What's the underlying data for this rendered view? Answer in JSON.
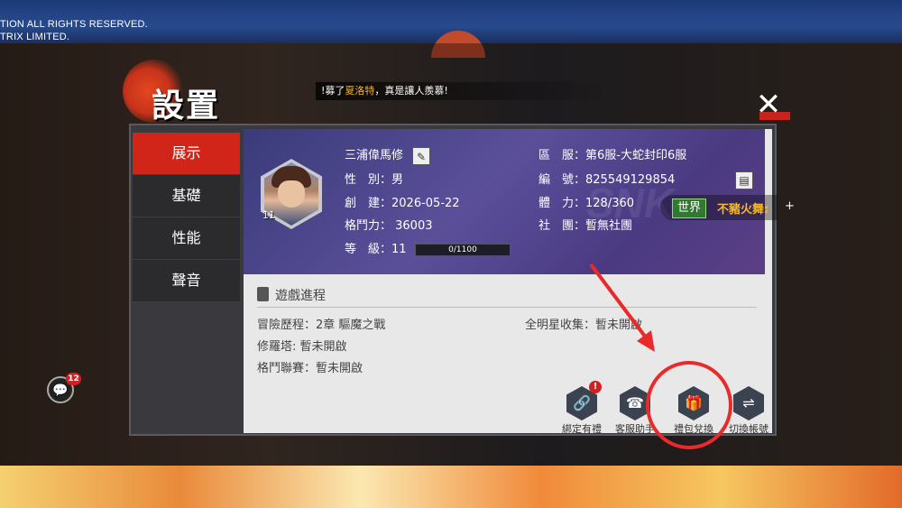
{
  "copyright": {
    "line1": "TION ALL RIGHTS RESERVED.",
    "line2": "TRIX LIMITED."
  },
  "header": {
    "title": "設置",
    "ticker_prefix": "!募了",
    "ticker_name": "夏洛特",
    "ticker_suffix": "，真是讓人羨慕!"
  },
  "close_label": "✕",
  "sidebar": {
    "items": [
      {
        "label": "展示",
        "active": true
      },
      {
        "label": "基礎",
        "active": false
      },
      {
        "label": "性能",
        "active": false
      },
      {
        "label": "聲音",
        "active": false
      }
    ]
  },
  "profile": {
    "name": "三浦偉馬修",
    "avatar_level": "11",
    "gender": "性　別：男",
    "created": "創　建：2026-05-22",
    "power": "格鬥力： 36003",
    "level": "等　級：11",
    "exp": "0/1100",
    "server": "區　服：第6服-大蛇封印6服",
    "id": "編　號：825549129854",
    "stamina": "體　力：128/360",
    "guild": "社　團：暫無社團"
  },
  "world_chat": {
    "tag": "世界",
    "message": "不豬火舞:",
    "plus": "+"
  },
  "progress": {
    "title": "遊戲進程",
    "adventure": "冒險歷程：2章  驅魔之戰",
    "tower": "修羅塔:    暫未開啟",
    "league": "格鬥聯賽：暫未開啟",
    "allstar": "全明星收集：暫未開啟"
  },
  "actions": [
    {
      "label": "綁定有禮",
      "icon": "link-icon",
      "glyph": "🔗",
      "badge": "!"
    },
    {
      "label": "客服助手",
      "icon": "headset-icon",
      "glyph": "☎",
      "badge": ""
    },
    {
      "label": "禮包兌換",
      "icon": "gift-icon",
      "glyph": "🎁",
      "badge": ""
    },
    {
      "label": "切換帳號",
      "icon": "switch-account-icon",
      "glyph": "⇌",
      "badge": ""
    }
  ],
  "chat_float": {
    "icon": "chat-bubble-icon",
    "count": "12"
  },
  "colors": {
    "accent_red": "#d22519",
    "annotation": "#ea2a2a",
    "highlight_gold": "#f2b632"
  }
}
